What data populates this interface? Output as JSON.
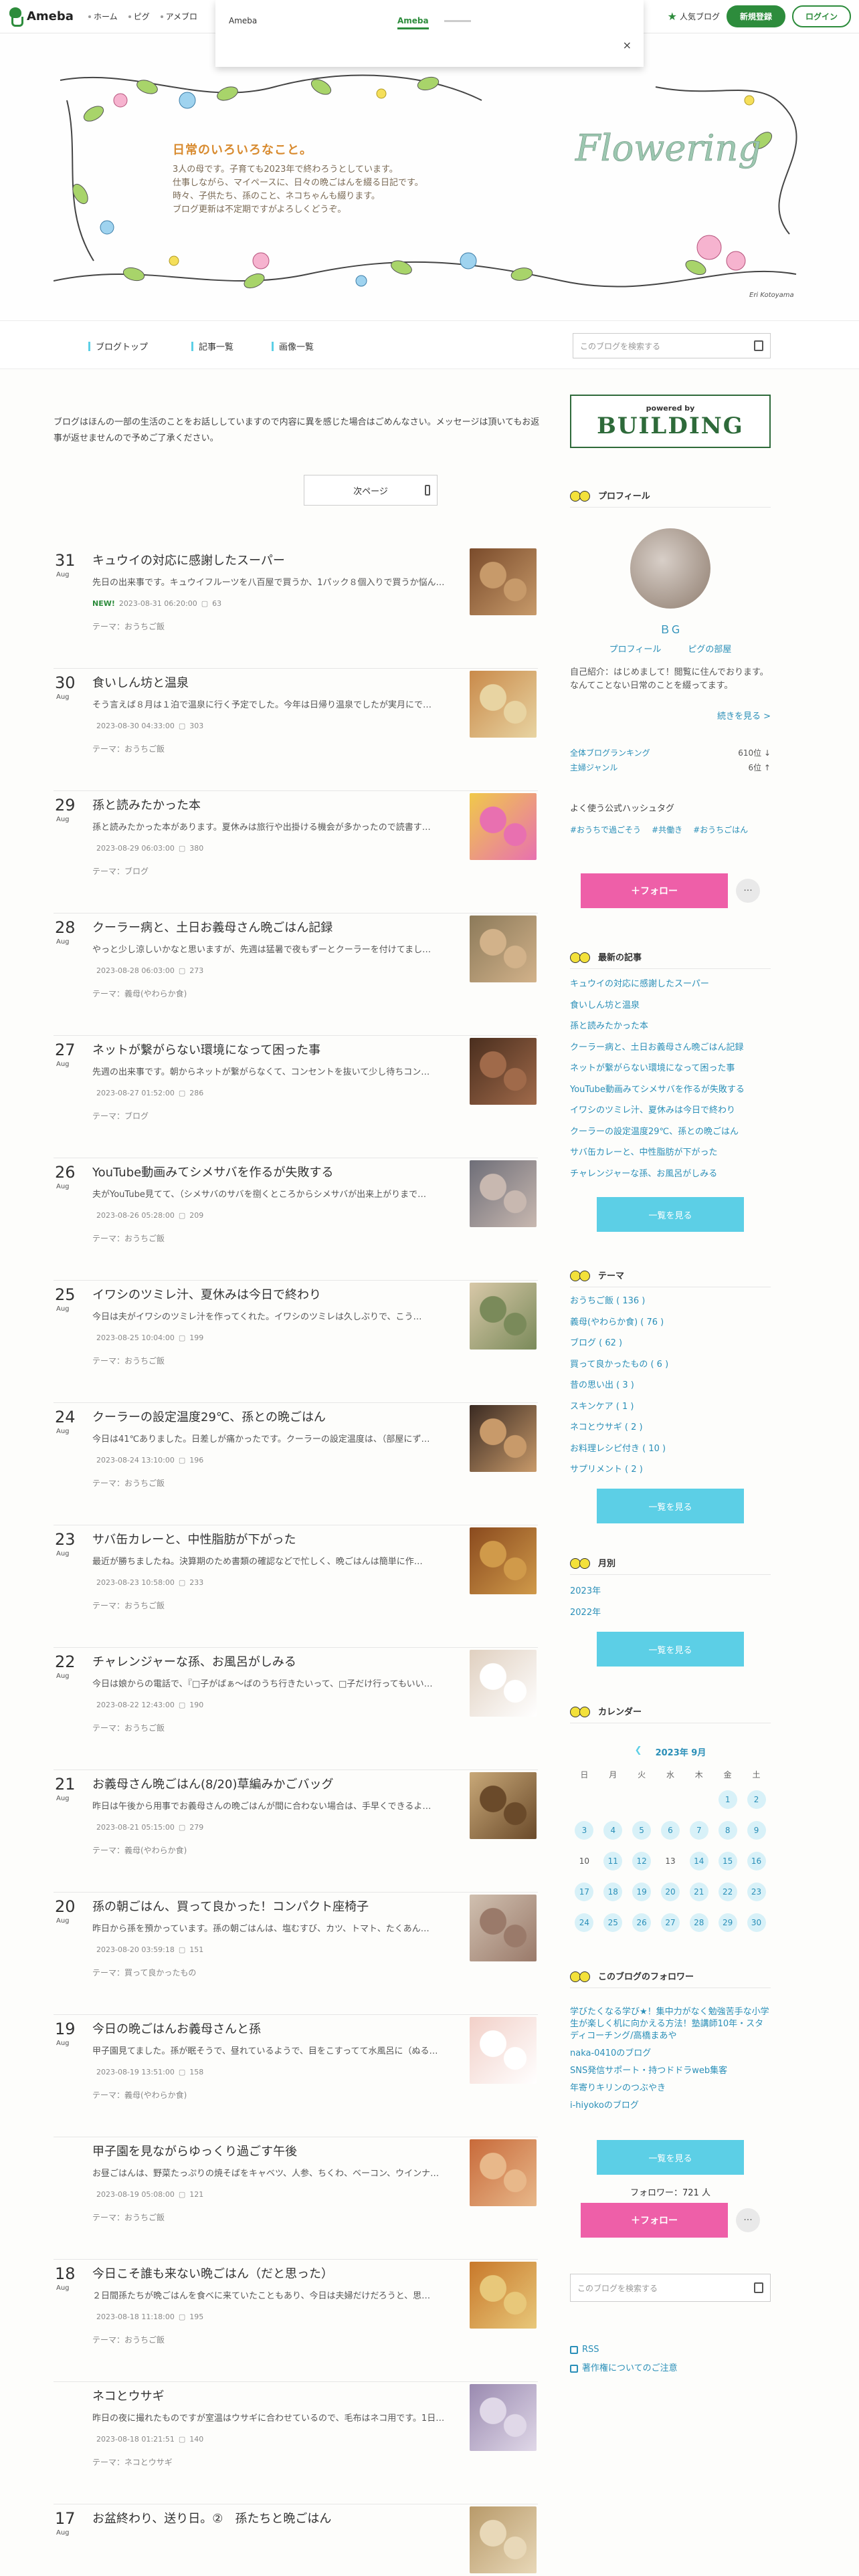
{
  "topbar": {
    "logo": "Ameba",
    "nav": [
      "ホーム",
      "ピグ",
      "アメブロ"
    ],
    "popular": "人気ブログ",
    "register": "新規登録",
    "login": "ログイン"
  },
  "dropdown": {
    "title": "Ameba",
    "tab": "Ameba",
    "close": "×"
  },
  "header": {
    "title": "日常のいろいろなこと。",
    "desc": [
      "3人の母です。子育ても2023年で終わろうとしています。",
      "仕事しながら、マイペースに、日々の晩ごはんを綴る日記です。",
      "時々、子供たち、孫のこと、ネコちゃんも綴ります。",
      "ブログ更新は不定期ですがよろしくどうぞ。"
    ],
    "flowering": "Flowering",
    "signature": "Eri Kotoyama"
  },
  "navbar": {
    "items": [
      "ブログトップ",
      "記事一覧",
      "画像一覧"
    ],
    "search_placeholder": "このブログを検索する"
  },
  "notice": "ブログはほんの一部の生活のことをお話ししていますので内容に異を感じた場合はごめんなさい。メッセージは頂いてもお返事が返せませんので予めご了承ください。",
  "next_page": "次ページ",
  "entries": [
    {
      "day": "31",
      "month": "Aug",
      "title": "キュウイの対応に感謝したスーパー",
      "excerpt": "先日の出来事です。キュウイフルーツを八百屋で買うか、1パック８個入りで買うか悩ん…",
      "new": "NEW!",
      "date": "2023-08-31 06:20:00",
      "comments": "63",
      "theme": "テーマ：おうちご飯"
    },
    {
      "day": "30",
      "month": "Aug",
      "title": "食いしん坊と温泉",
      "excerpt": "そう言えば８月は１泊で温泉に行く予定でした。今年は日帰り温泉でしたが実月にで…",
      "new": "",
      "date": "2023-08-30 04:33:00",
      "comments": "303",
      "theme": "テーマ：おうちご飯"
    },
    {
      "day": "29",
      "month": "Aug",
      "title": "孫と読みたかった本",
      "excerpt": "孫と読みたかった本があります。夏休みは旅行や出掛ける機会が多かったので読書す…",
      "new": "",
      "date": "2023-08-29 06:03:00",
      "comments": "380",
      "theme": "テーマ：ブログ"
    },
    {
      "day": "28",
      "month": "Aug",
      "title": "クーラー病と、土日お義母さん晩ごはん記録",
      "excerpt": "やっと少し涼しいかなと思いますが、先週は猛暑で夜もずーとクーラーを付けてまし…",
      "new": "",
      "date": "2023-08-28 06:03:00",
      "comments": "273",
      "theme": "テーマ：義母(やわらか食)"
    },
    {
      "day": "27",
      "month": "Aug",
      "title": "ネットが繋がらない環境になって困った事",
      "excerpt": "先週の出来事です。朝からネットが繋がらなくて、コンセントを抜いて少し待ちコン…",
      "new": "",
      "date": "2023-08-27 01:52:00",
      "comments": "286",
      "theme": "テーマ：ブログ"
    },
    {
      "day": "26",
      "month": "Aug",
      "title": "YouTube動画みてシメサバを作るが失敗する",
      "excerpt": "夫がYouTube見てて、（シメサバのサバを捌くところからシメサバが出来上がりまで…",
      "new": "",
      "date": "2023-08-26 05:28:00",
      "comments": "209",
      "theme": "テーマ：おうちご飯"
    },
    {
      "day": "25",
      "month": "Aug",
      "title": "イワシのツミレ汁、夏休みは今日で終わり",
      "excerpt": "今日は夫がイワシのツミレ汁を作ってくれた。イワシのツミレは久しぶりで、こう…",
      "new": "",
      "date": "2023-08-25 10:04:00",
      "comments": "199",
      "theme": "テーマ：おうちご飯"
    },
    {
      "day": "24",
      "month": "Aug",
      "title": "クーラーの設定温度29℃、孫との晩ごはん",
      "excerpt": "今日は41℃ありました。日差しが痛かったです。クーラーの設定温度は、（部屋にず…",
      "new": "",
      "date": "2023-08-24 13:10:00",
      "comments": "196",
      "theme": "テーマ：おうちご飯"
    },
    {
      "day": "23",
      "month": "Aug",
      "title": "サバ缶カレーと、中性脂肪が下がった",
      "excerpt": "最近が勝ちましたね。決算期のため書類の確認などで忙しく、晩ごはんは簡単に作…",
      "new": "",
      "date": "2023-08-23 10:58:00",
      "comments": "233",
      "theme": "テーマ：おうちご飯"
    },
    {
      "day": "22",
      "month": "Aug",
      "title": "チャレンジャーな孫、お風呂がしみる",
      "excerpt": "今日は娘からの電話で、『□子がばぁ～ばのうち行きたいって、□子だけ行ってもいい…",
      "new": "",
      "date": "2023-08-22 12:43:00",
      "comments": "190",
      "theme": "テーマ：おうちご飯"
    },
    {
      "day": "21",
      "month": "Aug",
      "title": "お義母さん晩ごはん(8/20)草編みかごバッグ",
      "excerpt": "昨日は午後から用事でお義母さんの晩ごはんが間に合わない場合は、手早くできるよ…",
      "new": "",
      "date": "2023-08-21 05:15:00",
      "comments": "279",
      "theme": "テーマ：義母(やわらか食)"
    },
    {
      "day": "20",
      "month": "Aug",
      "title": "孫の朝ごはん、買って良かった！コンパクト座椅子",
      "excerpt": "昨日から孫を預かっています。孫の朝ごはんは、塩むすび、カツ、トマト、たくあん…",
      "new": "",
      "date": "2023-08-20 03:59:18",
      "comments": "151",
      "theme": "テーマ：買って良かったもの"
    },
    {
      "day": "19",
      "month": "Aug",
      "title": "今日の晩ごはんお義母さんと孫",
      "excerpt": "甲子園見てました。孫が眠そうで、昼れているようで、目をこすってて水風呂に（ぬる…",
      "new": "",
      "date": "2023-08-19 13:51:00",
      "comments": "158",
      "theme": "テーマ：義母(やわらか食)"
    },
    {
      "day": "",
      "month": "",
      "title": "甲子園を見ながらゆっくり過ごす午後",
      "excerpt": "お昼ごはんは、野菜たっぷりの焼そばをキャベツ、人参、ちくわ、ベーコン、ウインナ…",
      "new": "",
      "date": "2023-08-19 05:08:00",
      "comments": "121",
      "theme": "テーマ：おうちご飯"
    },
    {
      "day": "18",
      "month": "Aug",
      "title": "今日こそ誰も来ない晩ごはん（だと思った）",
      "excerpt": "２日間孫たちが晩ごはんを食べに来ていたこともあり、今日は夫婦だけだろうと、思…",
      "new": "",
      "date": "2023-08-18 11:18:00",
      "comments": "195",
      "theme": "テーマ：おうちご飯"
    },
    {
      "day": "",
      "month": "",
      "title": "ネコとウサギ",
      "excerpt": "昨日の夜に撮れたものですが室温はウサギに合わせているので、毛布はネコ用です。1日…",
      "new": "",
      "date": "2023-08-18 01:21:51",
      "comments": "140",
      "theme": "テーマ：ネコとウサギ"
    },
    {
      "day": "17",
      "month": "Aug",
      "title": "お盆終わり、送り日。②　孫たちと晩ごはん",
      "excerpt": "",
      "new": "",
      "date": "",
      "comments": "",
      "theme": ""
    }
  ],
  "sidebar": {
    "powered_by": "powered by",
    "building": "BUILDING",
    "profile_head": "プロフィール",
    "profile_name": "ＢＧ",
    "profile_links": [
      "プロフィール",
      "ピグの部屋"
    ],
    "profile_text": "自己紹介：はじめまして！閲覧に住んでおります。なんてことない日常のことを綴ってます。",
    "profile_more": "続きを見る >",
    "ranking": [
      {
        "label": "全体ブログランキング",
        "value": "610位 ↓"
      },
      {
        "label": "主婦ジャンル",
        "value": "6位 ↑"
      }
    ],
    "hashtag_head": "よく使う公式ハッシュタグ",
    "hashtags": [
      "#おうちで過ごそう",
      "#共働き",
      "#おうちごはん"
    ],
    "follow": "＋フォロー",
    "more": "···",
    "recent_head": "最新の記事",
    "recent": [
      "キュウイの対応に感謝したスーパー",
      "食いしん坊と温泉",
      "孫と読みたかった本",
      "クーラー病と、土日お義母さん晩ごはん記録",
      "ネットが繋がらない環境になって困った事",
      "YouTube動画みてシメサバを作るが失敗する",
      "イワシのツミレ汁、夏休みは今日で終わり",
      "クーラーの設定温度29℃、孫との晩ごはん",
      "サバ缶カレーと、中性脂肪が下がった",
      "チャレンジャーな孫、お風呂がしみる"
    ],
    "list_btn": "一覧を見る",
    "theme_head": "テーマ",
    "themes": [
      "おうちご飯 ( 136 )",
      "義母(やわらか食) ( 76 )",
      "ブログ ( 62 )",
      "買って良かったもの ( 6 )",
      "昔の思い出 ( 3 )",
      "スキンケア ( 1 )",
      "ネコとウサギ ( 2 )",
      "お料理レシピ付き ( 10 )",
      "サプリメント ( 2 )"
    ],
    "month_head": "月別",
    "months": [
      "2023年",
      "2022年"
    ],
    "calendar_head": "カレンダー",
    "calendar_title": "2023年 9月",
    "weekdays": [
      "日",
      "月",
      "火",
      "水",
      "木",
      "金",
      "土"
    ],
    "weeks": [
      [
        "",
        "",
        "",
        "",
        "",
        "1",
        "2"
      ],
      [
        "3",
        "4",
        "5",
        "6",
        "7",
        "8",
        "9"
      ],
      [
        "10",
        "11",
        "12",
        "13",
        "14",
        "15",
        "16"
      ],
      [
        "17",
        "18",
        "19",
        "20",
        "21",
        "22",
        "23"
      ],
      [
        "24",
        "25",
        "26",
        "27",
        "28",
        "29",
        "30"
      ]
    ],
    "readers_head": "このブログのフォロワー",
    "readers": [
      "学びたくなる学び★！集中力がなく勉強苦手な小学生が楽しく机に向かえる方法！塾講師10年・スタディコーチング/高橋まあや",
      "naka-0410のブログ",
      "SNS発信サポート・持つドドラweb集客",
      "年寄りキリンのつぶやき",
      "i-hiyokoのブログ"
    ],
    "follower_count": "フォロワー：721 人",
    "search_placeholder": "このブログを検索する",
    "rss": "RSS",
    "copyright": "著作権についてのご注意"
  },
  "colors": {
    "accent": "#2d8c3c",
    "link": "#2a8fb8",
    "follow": "#ee5fa8",
    "list_button": "#5ccfe6"
  }
}
